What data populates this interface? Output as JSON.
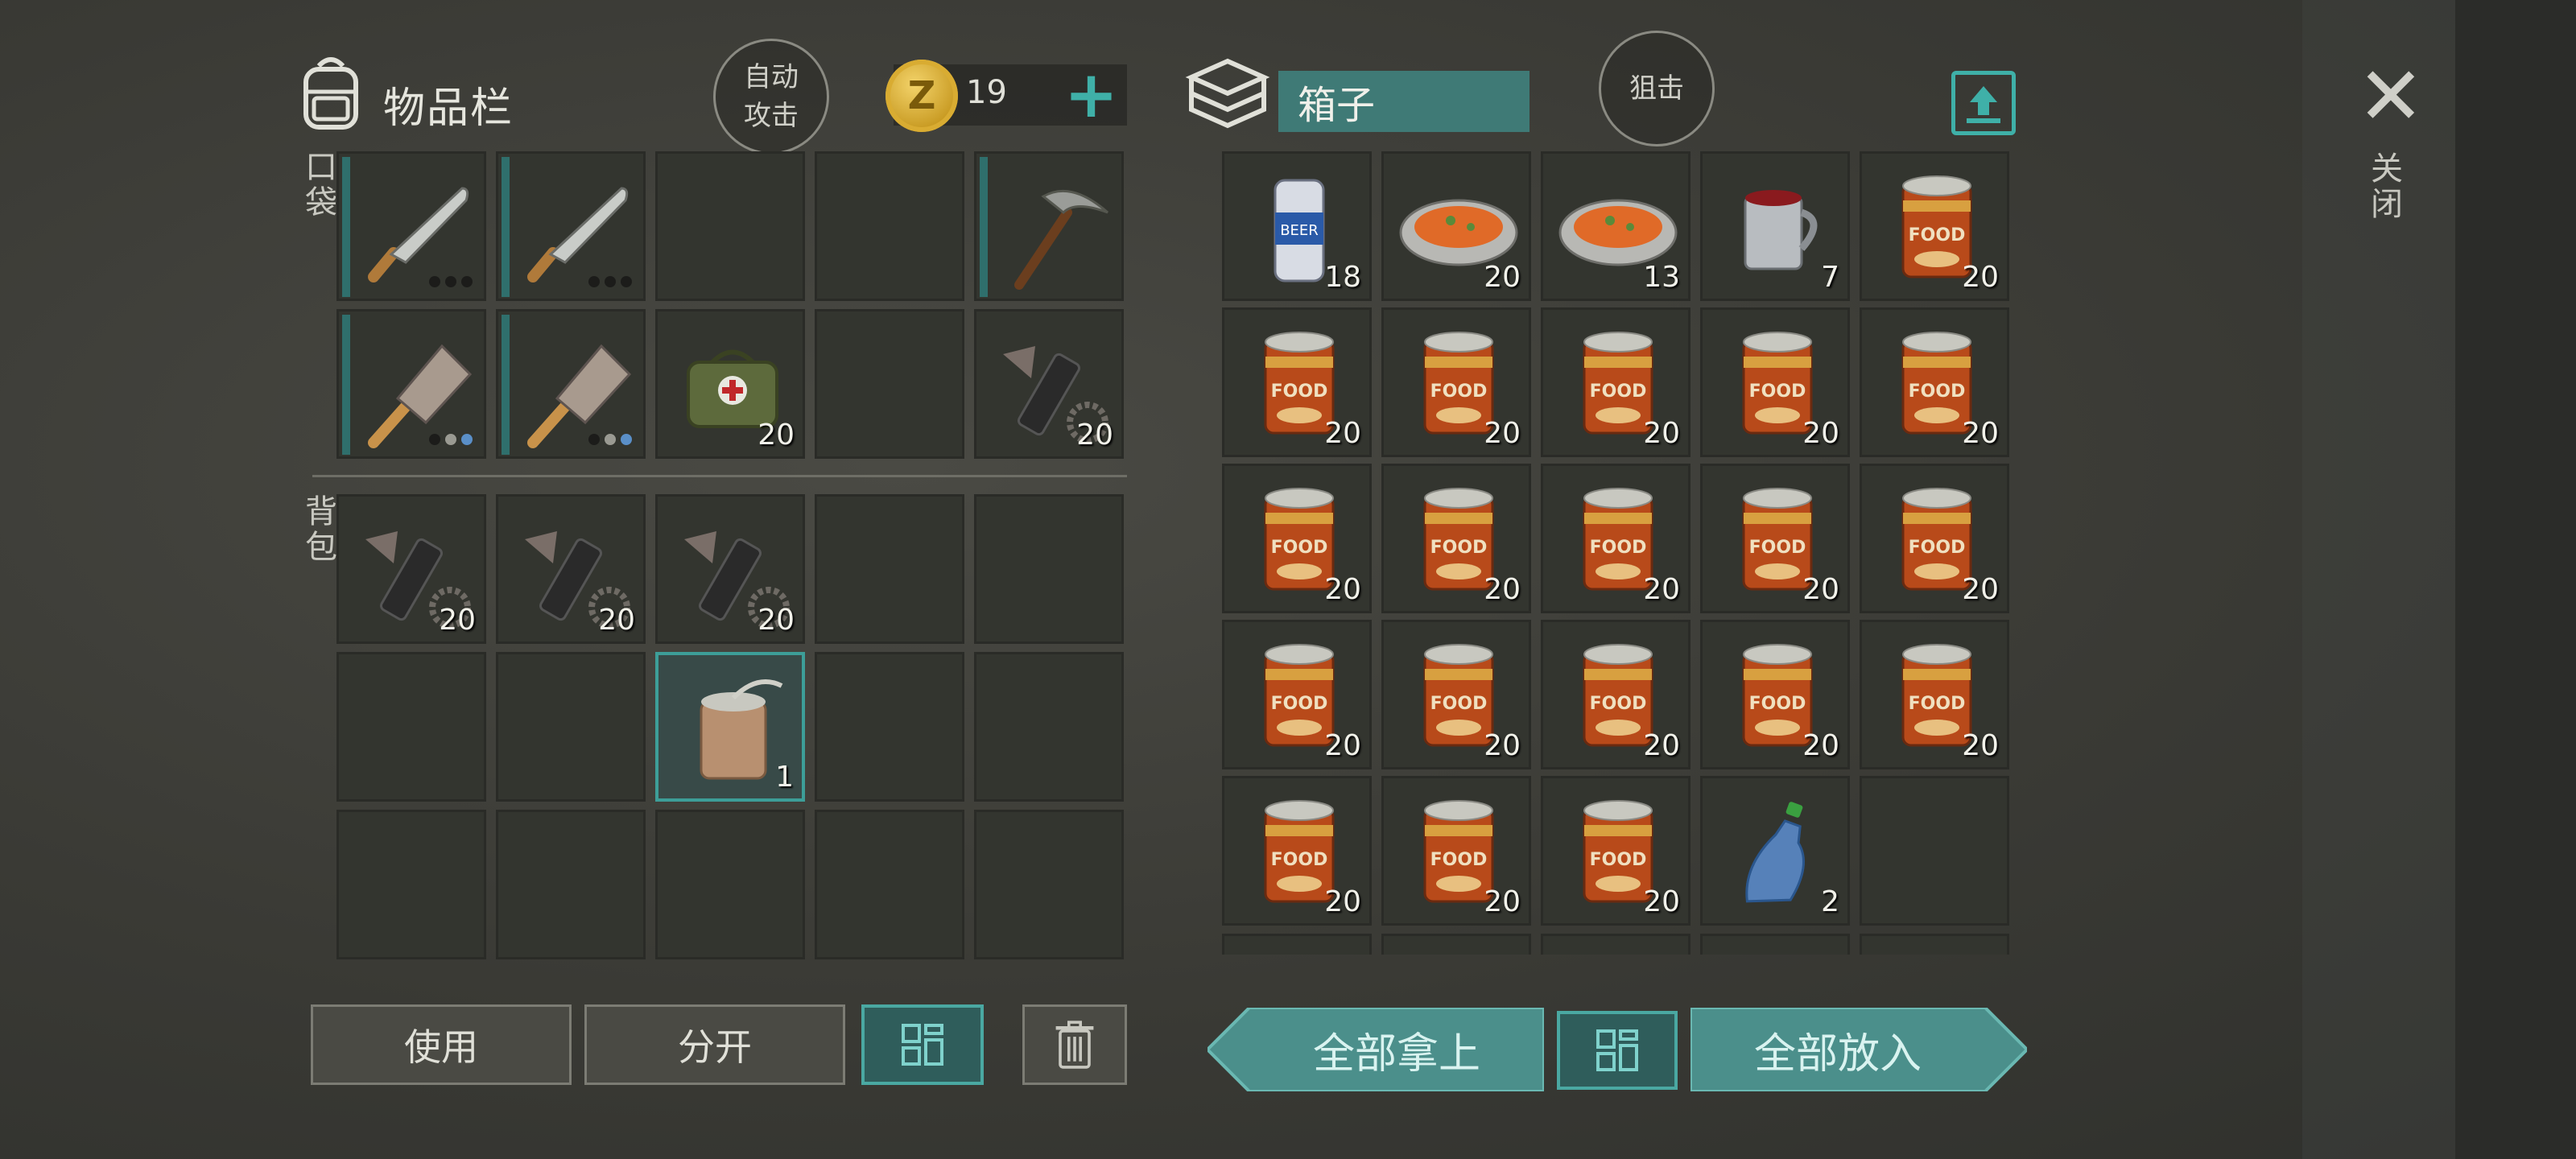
{
  "inventory": {
    "title": "物品栏",
    "auto_attack_label": "自动\n攻击",
    "coins": "19",
    "pocket_label": "口袋",
    "backpack_label": "背包",
    "pocket": [
      {
        "icon": "machete-icon",
        "count": "",
        "dots": [
          "d",
          "d",
          "d"
        ],
        "dur": true
      },
      {
        "icon": "machete-icon",
        "count": "",
        "dots": [
          "d",
          "d",
          "d"
        ],
        "dur": true
      },
      {
        "icon": "",
        "count": ""
      },
      {
        "icon": "",
        "count": ""
      },
      {
        "icon": "pickaxe-icon",
        "count": "",
        "dur": true
      },
      {
        "icon": "cleaver-icon",
        "count": "",
        "dots": [
          "d",
          "g",
          "b"
        ],
        "dur": true
      },
      {
        "icon": "cleaver-icon",
        "count": "",
        "dots": [
          "d",
          "g",
          "b"
        ],
        "dur": true
      },
      {
        "icon": "medkit-bag-icon",
        "count": "20"
      },
      {
        "icon": "",
        "count": ""
      },
      {
        "icon": "weapon-parts-icon",
        "count": "20"
      }
    ],
    "backpack": [
      {
        "icon": "weapon-parts-icon",
        "count": "20"
      },
      {
        "icon": "weapon-parts-icon",
        "count": "20"
      },
      {
        "icon": "weapon-parts-icon",
        "count": "20"
      },
      {
        "icon": "",
        "count": ""
      },
      {
        "icon": "",
        "count": ""
      },
      {
        "icon": "",
        "count": ""
      },
      {
        "icon": "",
        "count": ""
      },
      {
        "icon": "open-can-icon",
        "count": "1",
        "selected": true
      },
      {
        "icon": "",
        "count": ""
      },
      {
        "icon": "",
        "count": ""
      },
      {
        "icon": "",
        "count": ""
      },
      {
        "icon": "",
        "count": ""
      },
      {
        "icon": "",
        "count": ""
      },
      {
        "icon": "",
        "count": ""
      },
      {
        "icon": "",
        "count": ""
      }
    ],
    "use_label": "使用",
    "split_label": "分开"
  },
  "box": {
    "title": "箱子",
    "snipe_label": "狙击",
    "slots": [
      {
        "icon": "beer-can-icon",
        "count": "18"
      },
      {
        "icon": "carrot-dish-icon",
        "count": "20"
      },
      {
        "icon": "carrot-dish-icon",
        "count": "13"
      },
      {
        "icon": "mug-icon",
        "count": "7"
      },
      {
        "icon": "food-can-icon",
        "count": "20"
      },
      {
        "icon": "food-can-icon",
        "count": "20"
      },
      {
        "icon": "food-can-icon",
        "count": "20"
      },
      {
        "icon": "food-can-icon",
        "count": "20"
      },
      {
        "icon": "food-can-icon",
        "count": "20"
      },
      {
        "icon": "food-can-icon",
        "count": "20"
      },
      {
        "icon": "food-can-icon",
        "count": "20"
      },
      {
        "icon": "food-can-icon",
        "count": "20"
      },
      {
        "icon": "food-can-icon",
        "count": "20"
      },
      {
        "icon": "food-can-icon",
        "count": "20"
      },
      {
        "icon": "food-can-icon",
        "count": "20"
      },
      {
        "icon": "food-can-icon",
        "count": "20"
      },
      {
        "icon": "food-can-icon",
        "count": "20"
      },
      {
        "icon": "food-can-icon",
        "count": "20"
      },
      {
        "icon": "food-can-icon",
        "count": "20"
      },
      {
        "icon": "food-can-icon",
        "count": "20"
      },
      {
        "icon": "food-can-icon",
        "count": "20"
      },
      {
        "icon": "food-can-icon",
        "count": "20"
      },
      {
        "icon": "food-can-icon",
        "count": "20"
      },
      {
        "icon": "water-bottle-icon",
        "count": "2"
      },
      {
        "icon": "",
        "count": ""
      }
    ],
    "take_all_label": "全部拿上",
    "put_all_label": "全部放入"
  },
  "close_label": "关闭",
  "colors": {
    "accent": "#3fb0a8",
    "selected_border": "#3d9e98",
    "slot_bg": "#33352f"
  }
}
